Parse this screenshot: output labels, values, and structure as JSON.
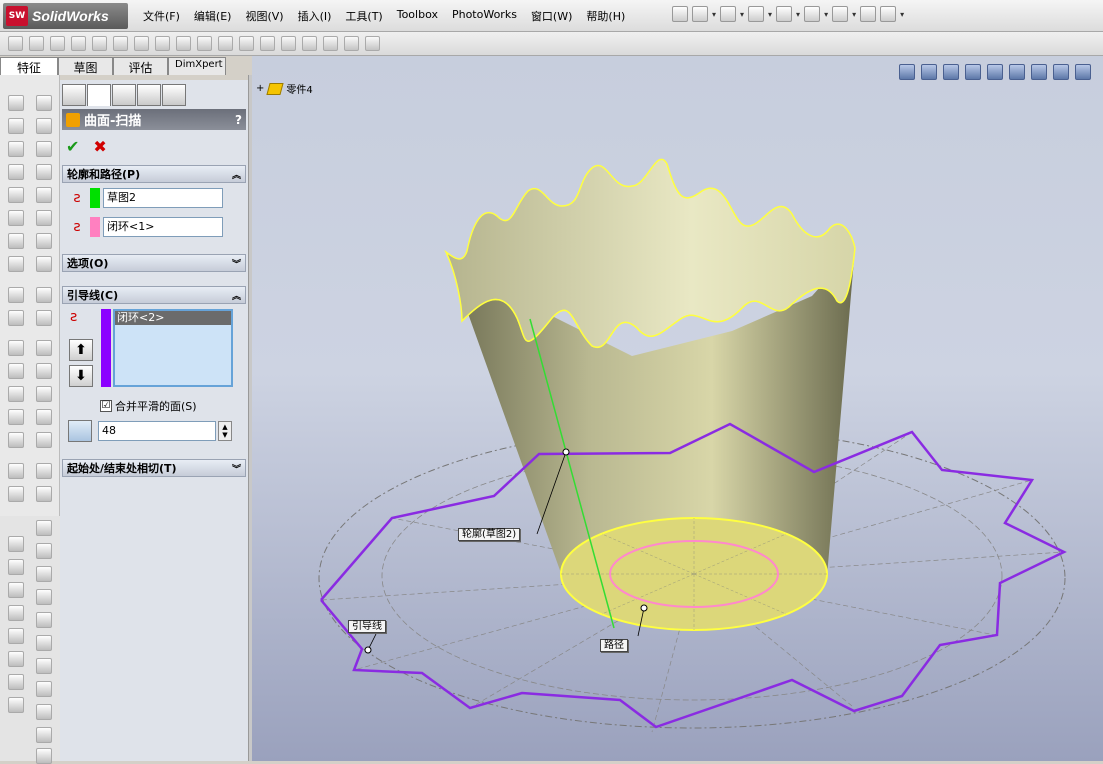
{
  "app": {
    "name": "SolidWorks",
    "logo_badge": "SW"
  },
  "menu": {
    "items": [
      "文件(F)",
      "编辑(E)",
      "视图(V)",
      "插入(I)",
      "工具(T)",
      "Toolbox",
      "PhotoWorks",
      "窗口(W)",
      "帮助(H)"
    ]
  },
  "command_tabs": [
    "特征",
    "草图",
    "评估",
    "DimXpert"
  ],
  "feature": {
    "title": "曲面-扫描",
    "help": "?"
  },
  "groups": {
    "profile_path": "轮廓和路径(P)",
    "options": "选项(O)",
    "guide_curves": "引导线(C)",
    "tangency": "起始处/结束处相切(T)"
  },
  "fields": {
    "profile": "草图2",
    "path": "闭环<1>",
    "guide": "闭环<2>",
    "merge_label": "合并平滑的面(S)",
    "merge_checked": "☑",
    "tess_value": "48"
  },
  "tree": {
    "part": "零件4"
  },
  "callouts": {
    "profile": "轮廓(草图2)",
    "guide": "引导线",
    "path": "路径"
  },
  "colors": {
    "profile_swatch": "#00e000",
    "path_swatch": "#ff80c0",
    "guide_swatch": "#8b00ff",
    "guide_curve": "#8a2be2",
    "path_circle": "#ff88cc",
    "edge_yellow": "#ffff40"
  },
  "icons": {
    "ok": "✔",
    "cancel": "✖",
    "up": "⬆",
    "down": "⬇",
    "collapse": "︽",
    "expand": "︾"
  }
}
